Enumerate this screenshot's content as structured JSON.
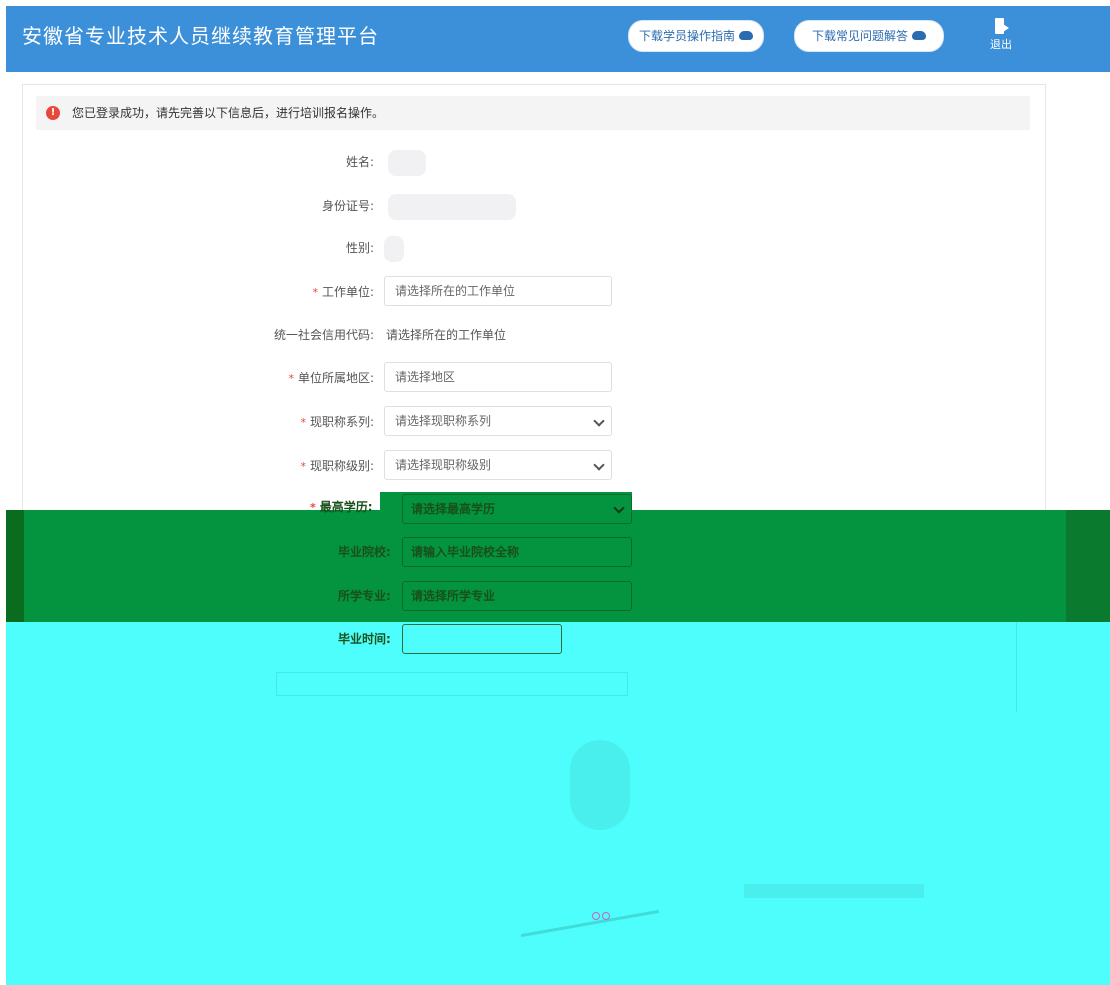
{
  "header": {
    "title": "安徽省专业技术人员继续教育管理平台",
    "guide_button": "下载学员操作指南",
    "faq_button": "下载常见问题解答",
    "logout": "退出"
  },
  "alert": {
    "message": "您已登录成功，请先完善以下信息后，进行培训报名操作。"
  },
  "form": {
    "name_label": "姓名:",
    "id_label": "身份证号:",
    "gender_label": "性别:",
    "work_unit": {
      "label": "工作单位:",
      "placeholder": "请选择所在的工作单位"
    },
    "credit_code": {
      "label": "统一社会信用代码:",
      "value": "请选择所在的工作单位"
    },
    "region": {
      "label": "单位所属地区:",
      "placeholder": "请选择地区"
    },
    "title_series": {
      "label": "现职称系列:",
      "value": "请选择现职称系列"
    },
    "title_level": {
      "label": "现职称级别:",
      "value": "请选择现职称级别"
    },
    "education": {
      "label": "最高学历:",
      "value": "请选择最高学历"
    },
    "school": {
      "label": "毕业院校:",
      "placeholder": "请输入毕业院校全称"
    },
    "major": {
      "label": "所学专业:",
      "placeholder": "请选择所学专业"
    },
    "grad_time": {
      "label": "毕业时间:"
    }
  }
}
